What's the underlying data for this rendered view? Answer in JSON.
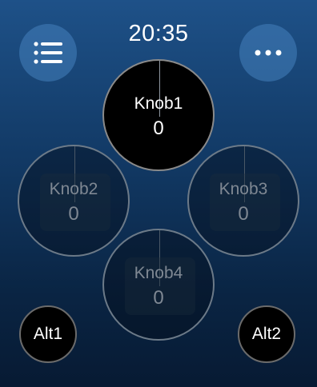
{
  "status": {
    "time": "20:35"
  },
  "toolbar": {
    "menu_icon": "list-icon",
    "more_icon": "ellipsis-icon"
  },
  "knobs": [
    {
      "label": "Knob1",
      "value": "0",
      "state": "active"
    },
    {
      "label": "Knob2",
      "value": "0",
      "state": "inactive"
    },
    {
      "label": "Knob3",
      "value": "0",
      "state": "inactive"
    },
    {
      "label": "Knob4",
      "value": "0",
      "state": "inactive"
    }
  ],
  "alt_buttons": [
    {
      "label": "Alt1"
    },
    {
      "label": "Alt2"
    }
  ],
  "colors": {
    "background_top": "#1e5188",
    "background_bottom": "#071a33",
    "corner_button": "#4682be",
    "active_knob": "#000000",
    "inactive_text": "#7f8893"
  }
}
